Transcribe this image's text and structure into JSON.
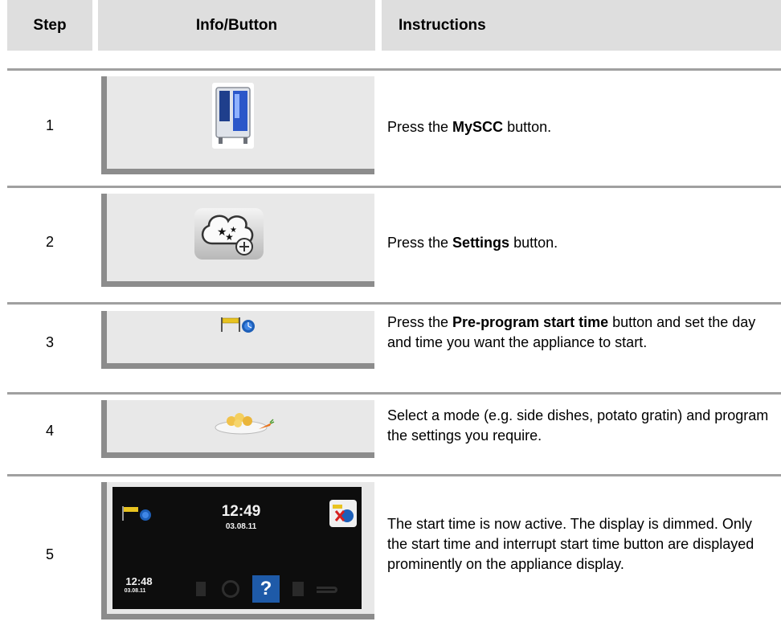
{
  "header": {
    "step": "Step",
    "info_button": "Info/Button",
    "instructions": "Instructions"
  },
  "rows": [
    {
      "step": "1",
      "icon": "myscc-appliance-icon",
      "pre": "Press the ",
      "bold": "MySCC",
      "post": " button."
    },
    {
      "step": "2",
      "icon": "settings-stars-icon",
      "pre": "Press the ",
      "bold": "Settings",
      "post": " button."
    },
    {
      "step": "3",
      "icon": "pre-program-start-time-icon",
      "pre": "Press the ",
      "bold": "Pre-program start time",
      "post": " button and set the day and time you want the appliance to start."
    },
    {
      "step": "4",
      "icon": "side-dishes-mode-icon",
      "text": "Select a mode (e.g. side dishes, potato gratin) and program the settings you require."
    },
    {
      "step": "5",
      "icon": "appliance-display-screenshot",
      "text": "The start time is now active. The display is dimmed. Only the start time and interrupt start time button are displayed prominently on the appliance display.",
      "screen": {
        "start_time": "12:49",
        "start_date": "03.08.11",
        "clock_time": "12:48",
        "clock_date": "03.08.11",
        "help_glyph": "?"
      }
    }
  ],
  "colors": {
    "header_bg": "#dedede",
    "panel_bg": "#e8e8e8",
    "panel_shadow": "#8c8c8c",
    "divider": "#a0a0a0"
  }
}
